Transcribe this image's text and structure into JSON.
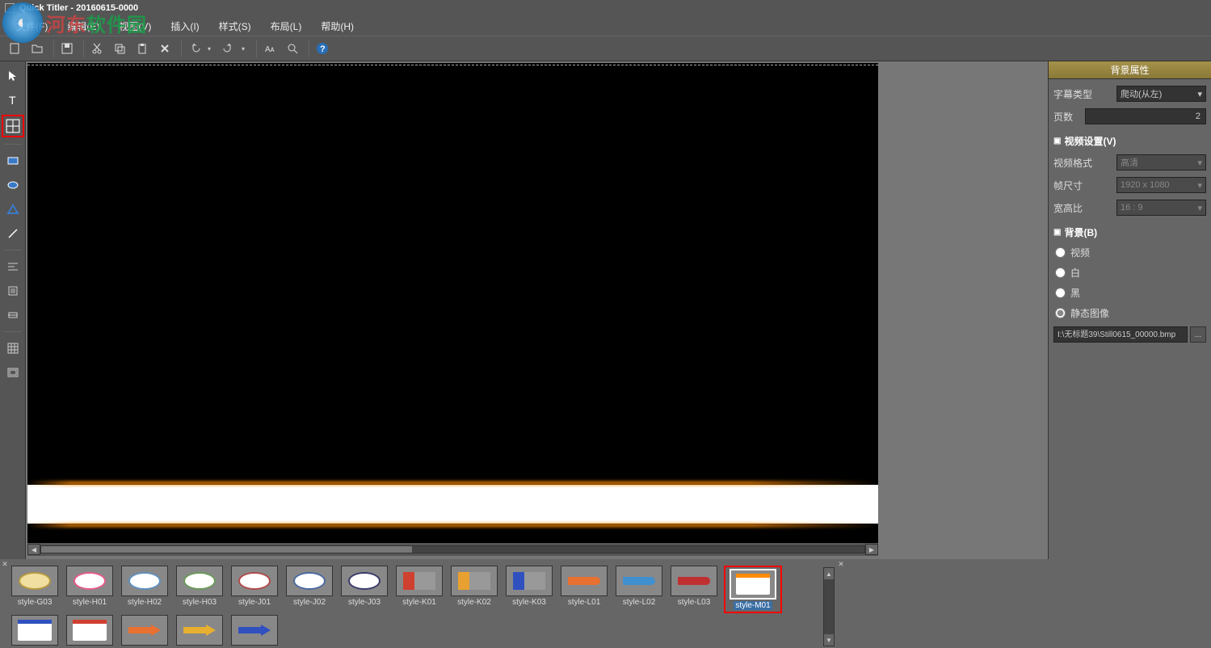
{
  "titlebar": {
    "title": "Quick Titler - 20160615-0000"
  },
  "watermark": {
    "text1": "河东",
    "text2": "软件园"
  },
  "menubar": {
    "items": [
      {
        "label": "文件(F)"
      },
      {
        "label": "编辑(E)"
      },
      {
        "label": "视图(V)"
      },
      {
        "label": "插入(I)"
      },
      {
        "label": "样式(S)"
      },
      {
        "label": "布局(L)"
      },
      {
        "label": "帮助(H)"
      }
    ]
  },
  "panel": {
    "header": "背景属性",
    "subtitle_type_label": "字幕类型",
    "subtitle_type_value": "爬动(从左)",
    "pages_label": "页数",
    "pages_value": "2",
    "video_section": "视频设置(V)",
    "video_format_label": "视频格式",
    "video_format_value": "高清",
    "frame_size_label": "帧尺寸",
    "frame_size_value": "1920 x 1080",
    "aspect_label": "宽高比",
    "aspect_value": "16 : 9",
    "bg_section": "背景(B)",
    "radio_video": "视频",
    "radio_white": "白",
    "radio_black": "黑",
    "radio_still": "静态图像",
    "path_value": "I:\\无标题39\\Still0615_00000.bmp",
    "browse": "..."
  },
  "styles": {
    "row1": [
      {
        "label": "style-G03",
        "kind": "bubble",
        "color": "#f0dfa0",
        "outline": "#b89a40"
      },
      {
        "label": "style-H01",
        "kind": "bubble",
        "color": "#fff",
        "outline": "#e85a8a"
      },
      {
        "label": "style-H02",
        "kind": "bubble",
        "color": "#fff",
        "outline": "#6090c0"
      },
      {
        "label": "style-H03",
        "kind": "bubble",
        "color": "#fff",
        "outline": "#6a9a5a"
      },
      {
        "label": "style-J01",
        "kind": "bubble",
        "color": "#fff",
        "outline": "#b04a4a"
      },
      {
        "label": "style-J02",
        "kind": "bubble",
        "color": "#fff",
        "outline": "#4a6aa0"
      },
      {
        "label": "style-J03",
        "kind": "bubble",
        "color": "#fff",
        "outline": "#3a3a6a"
      },
      {
        "label": "style-K01",
        "kind": "flag",
        "color": "#d04030"
      },
      {
        "label": "style-K02",
        "kind": "flag",
        "color": "#e8a030"
      },
      {
        "label": "style-K03",
        "kind": "flag",
        "color": "#3050c0"
      },
      {
        "label": "style-L01",
        "kind": "brush",
        "color": "#e87030"
      },
      {
        "label": "style-L02",
        "kind": "brush",
        "color": "#4090d0"
      },
      {
        "label": "style-L03",
        "kind": "brush",
        "color": "#c03030"
      },
      {
        "label": "style-M01",
        "kind": "card",
        "color": "#ff8c00",
        "selected": true
      }
    ],
    "row2": [
      {
        "label": "",
        "kind": "card",
        "color": "#3050c0"
      },
      {
        "label": "",
        "kind": "card",
        "color": "#d04030"
      },
      {
        "label": "",
        "kind": "arrow",
        "color": "#e87030"
      },
      {
        "label": "",
        "kind": "arrow",
        "color": "#e8b030"
      },
      {
        "label": "",
        "kind": "arrow",
        "color": "#3050c0"
      }
    ]
  }
}
